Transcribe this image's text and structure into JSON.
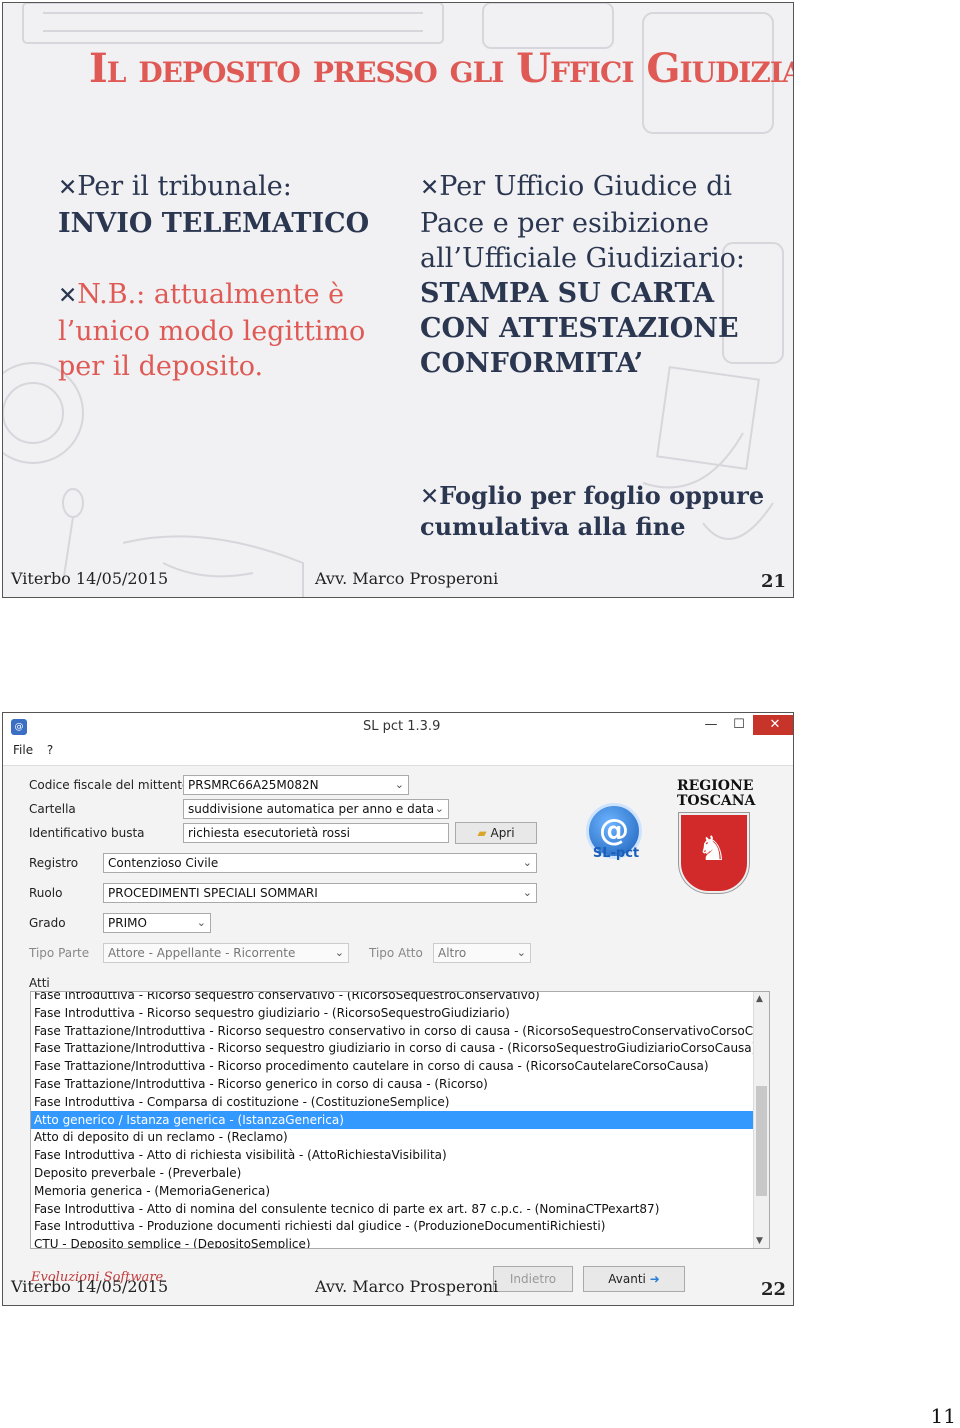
{
  "slide1": {
    "title": "Il deposito presso gli Uffici Giudiziari",
    "left_col": {
      "bullet1_prefix": "Per il tribunale:",
      "bullet1_bold": "INVIO TELEMATICO",
      "bullet2": "N.B.: attualmente è l’unico modo legittimo per il deposito."
    },
    "right_col": {
      "bullet1_prefix": "Per Ufficio Giudice di Pace e per esibizione all’Ufficiale Giudiziario:",
      "bullet1_bold": "STAMPA SU CARTA CON ATTESTAZIONE CONFORMITA’",
      "bullet2": "Foglio per foglio oppure cumulativa alla fine"
    },
    "footer_left": "Viterbo 14/05/2015",
    "footer_center": "Avv. Marco Prosperoni",
    "slide_number": "21"
  },
  "slide2": {
    "window_title": "SL pct 1.3.9",
    "menu": [
      "File",
      "?"
    ],
    "form": {
      "codice_fiscale_label": "Codice fiscale del mittente",
      "codice_fiscale_value": "PRSMRC66A25M082N",
      "cartella_label": "Cartella",
      "cartella_value": "suddivisione automatica per anno e data",
      "ident_busta_label": "Identificativo busta",
      "ident_busta_value": "richiesta esecutorietà rossi",
      "apri_label": "Apri",
      "registro_label": "Registro",
      "registro_value": "Contenzioso Civile",
      "ruolo_label": "Ruolo",
      "ruolo_value": "PROCEDIMENTI SPECIALI SOMMARI",
      "grado_label": "Grado",
      "grado_value": "PRIMO",
      "tipo_parte_label": "Tipo Parte",
      "tipo_parte_value": "Attore - Appellante - Ricorrente",
      "tipo_atto_label": "Tipo Atto",
      "tipo_atto_value": "Altro",
      "atti_label": "Atti"
    },
    "logo_text": "SL-pct",
    "regione_text": "REGIONE TOSCANA",
    "atti_list": [
      "Fase Introduttiva - Ricorso sequestro conservativo - (RicorsoSequestroConservativo)",
      "Fase Introduttiva - Ricorso sequestro giudiziario - (RicorsoSequestroGiudiziario)",
      "Fase Trattazione/Introduttiva - Ricorso sequestro conservativo in corso di causa - (RicorsoSequestroConservativoCorsoCausa)",
      "Fase Trattazione/Introduttiva - Ricorso sequestro giudiziario in corso di causa - (RicorsoSequestroGiudiziarioCorsoCausa)",
      "Fase Trattazione/Introduttiva - Ricorso procedimento cautelare in corso di causa - (RicorsoCautelareCorsoCausa)",
      "Fase Trattazione/Introduttiva - Ricorso generico in corso di causa - (Ricorso)",
      "Fase Introduttiva - Comparsa di costituzione - (CostituzioneSemplice)",
      "Atto generico / Istanza generica - (IstanzaGenerica)",
      "Atto di deposito di un reclamo - (Reclamo)",
      "Fase Introduttiva - Atto di richiesta visibilità - (AttoRichiestaVisibilita)",
      "Deposito preverbale - (Preverbale)",
      "Memoria generica - (MemoriaGenerica)",
      "Fase Introduttiva - Atto di nomina del consulente tecnico di parte ex art. 87 c.p.c. - (NominaCTPexart87)",
      "Fase Introduttiva - Produzione documenti richiesti dal giudice - (ProduzioneDocumentiRichiesti)",
      "CTU - Deposito semplice - (DepositoSemplice)"
    ],
    "selected_index": 7,
    "indietro_label": "Indietro",
    "avanti_label": "Avanti",
    "evoluzioni_text": "Evoluzioni Software",
    "footer_left": "Viterbo 14/05/2015",
    "footer_center": "Avv. Marco Prosperoni",
    "slide_number": "22"
  },
  "page_number": "11"
}
